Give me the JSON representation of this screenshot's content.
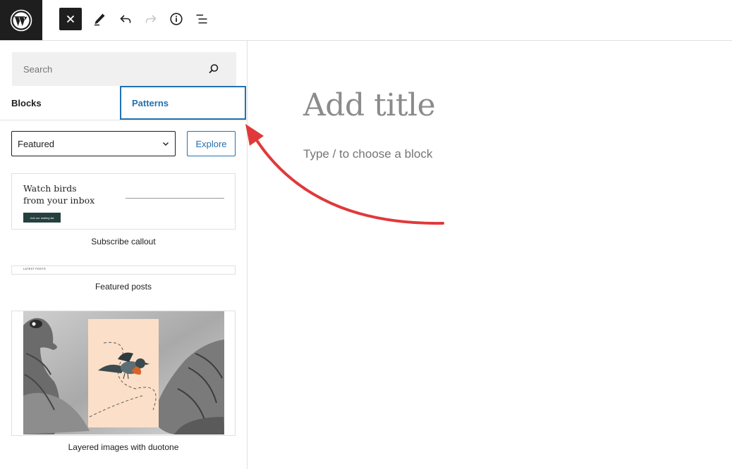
{
  "toolbar": {
    "logo_icon": "wordpress-icon",
    "close_icon": "close-icon",
    "tools_icon": "pencil-icon",
    "undo_icon": "undo-icon",
    "redo_icon": "redo-icon",
    "details_icon": "info-icon",
    "list_view_icon": "list-view-icon"
  },
  "inserter": {
    "search": {
      "placeholder": "Search",
      "value": ""
    },
    "tabs": [
      {
        "label": "Blocks"
      },
      {
        "label": "Patterns",
        "active": true
      }
    ],
    "category": {
      "selected": "Featured"
    },
    "explore_label": "Explore",
    "patterns": [
      {
        "label": "Subscribe callout",
        "preview_heading_line1": "Watch birds",
        "preview_heading_line2": "from your inbox",
        "preview_button": "Join our mailing list"
      },
      {
        "label": "Featured posts",
        "preview_text": "LATEST POSTS"
      },
      {
        "label": "Layered images with duotone"
      }
    ]
  },
  "editor": {
    "title_placeholder": "Add title",
    "block_placeholder": "Type / to choose a block"
  },
  "colors": {
    "accent": "#2271b1",
    "annotation": "#e0393a",
    "dark": "#1e1e1e"
  }
}
